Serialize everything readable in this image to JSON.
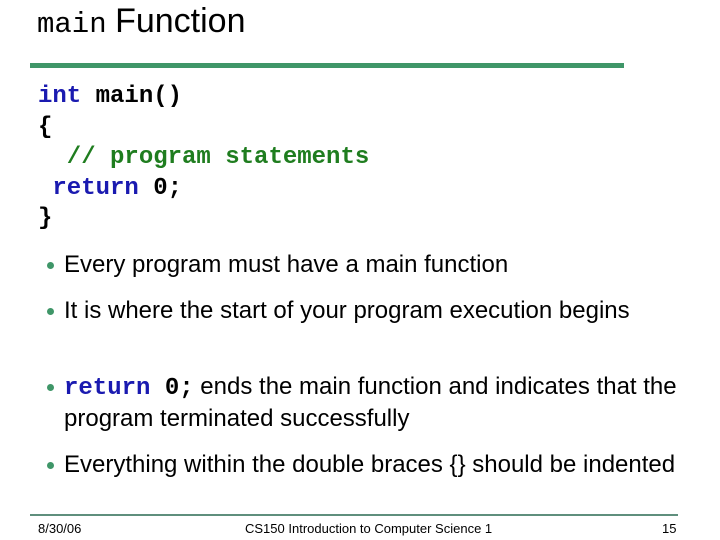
{
  "slide": {
    "title_code": "main",
    "title_text": "Function",
    "code_lines": [
      {
        "parts": [
          {
            "t": "int",
            "c": "kw"
          },
          {
            "t": " main()",
            "c": "pl"
          }
        ]
      },
      {
        "parts": [
          {
            "t": "{",
            "c": "pl"
          }
        ]
      },
      {
        "parts": [
          {
            "t": "  // program statements",
            "c": "cm"
          }
        ]
      },
      {
        "parts": [
          {
            "t": " return",
            "c": "kw"
          },
          {
            "t": " 0;",
            "c": "pl"
          }
        ]
      },
      {
        "parts": [
          {
            "t": "}",
            "c": "pl"
          }
        ]
      }
    ],
    "bullets": [
      {
        "text": "Every program must have a main function"
      },
      {
        "text": "It is where the start of your program execution begins"
      },
      {
        "code_kw": "return",
        "code_rest": " 0;",
        "text": " ends the main function and indicates that the program terminated successfully"
      },
      {
        "text": "Everything within the double braces {} should be indented"
      }
    ],
    "accent_color": "#3f9668",
    "keyword_color": "#1a1ab0",
    "comment_color": "#1f7d1f"
  },
  "footer": {
    "date": "8/30/06",
    "course": "CS150 Introduction to Computer Science 1",
    "page": "15"
  }
}
